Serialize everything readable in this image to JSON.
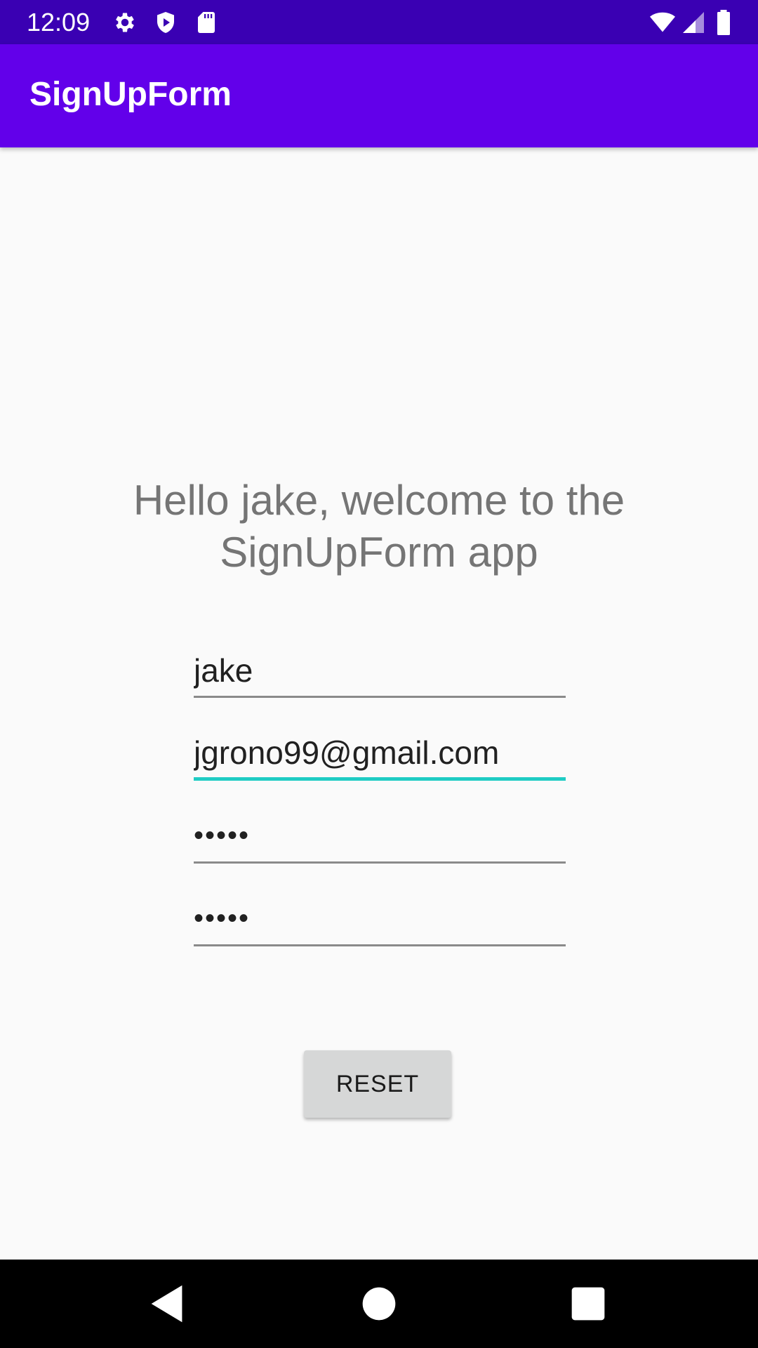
{
  "status_bar": {
    "time": "12:09",
    "left_icons": [
      "gear-icon",
      "shield-play-icon",
      "sd-card-icon"
    ],
    "right_icons": [
      "wifi-icon",
      "cell-signal-icon",
      "battery-icon"
    ],
    "background": "#3a00b3"
  },
  "app_bar": {
    "title": "SignUpForm",
    "background": "#6200ea"
  },
  "welcome": {
    "line1": "Hello jake, welcome to the",
    "line2": "SignUpForm app"
  },
  "form": {
    "name_value": "jake",
    "email_value": "jgrono99@gmail.com",
    "password_value": "•••••",
    "confirm_password_value": "•••••",
    "focused_field": "email",
    "focus_color": "#1fccc4"
  },
  "buttons": {
    "reset_label": "RESET"
  },
  "nav_bar": {
    "icons": [
      "back-icon",
      "home-icon",
      "recents-icon"
    ]
  }
}
